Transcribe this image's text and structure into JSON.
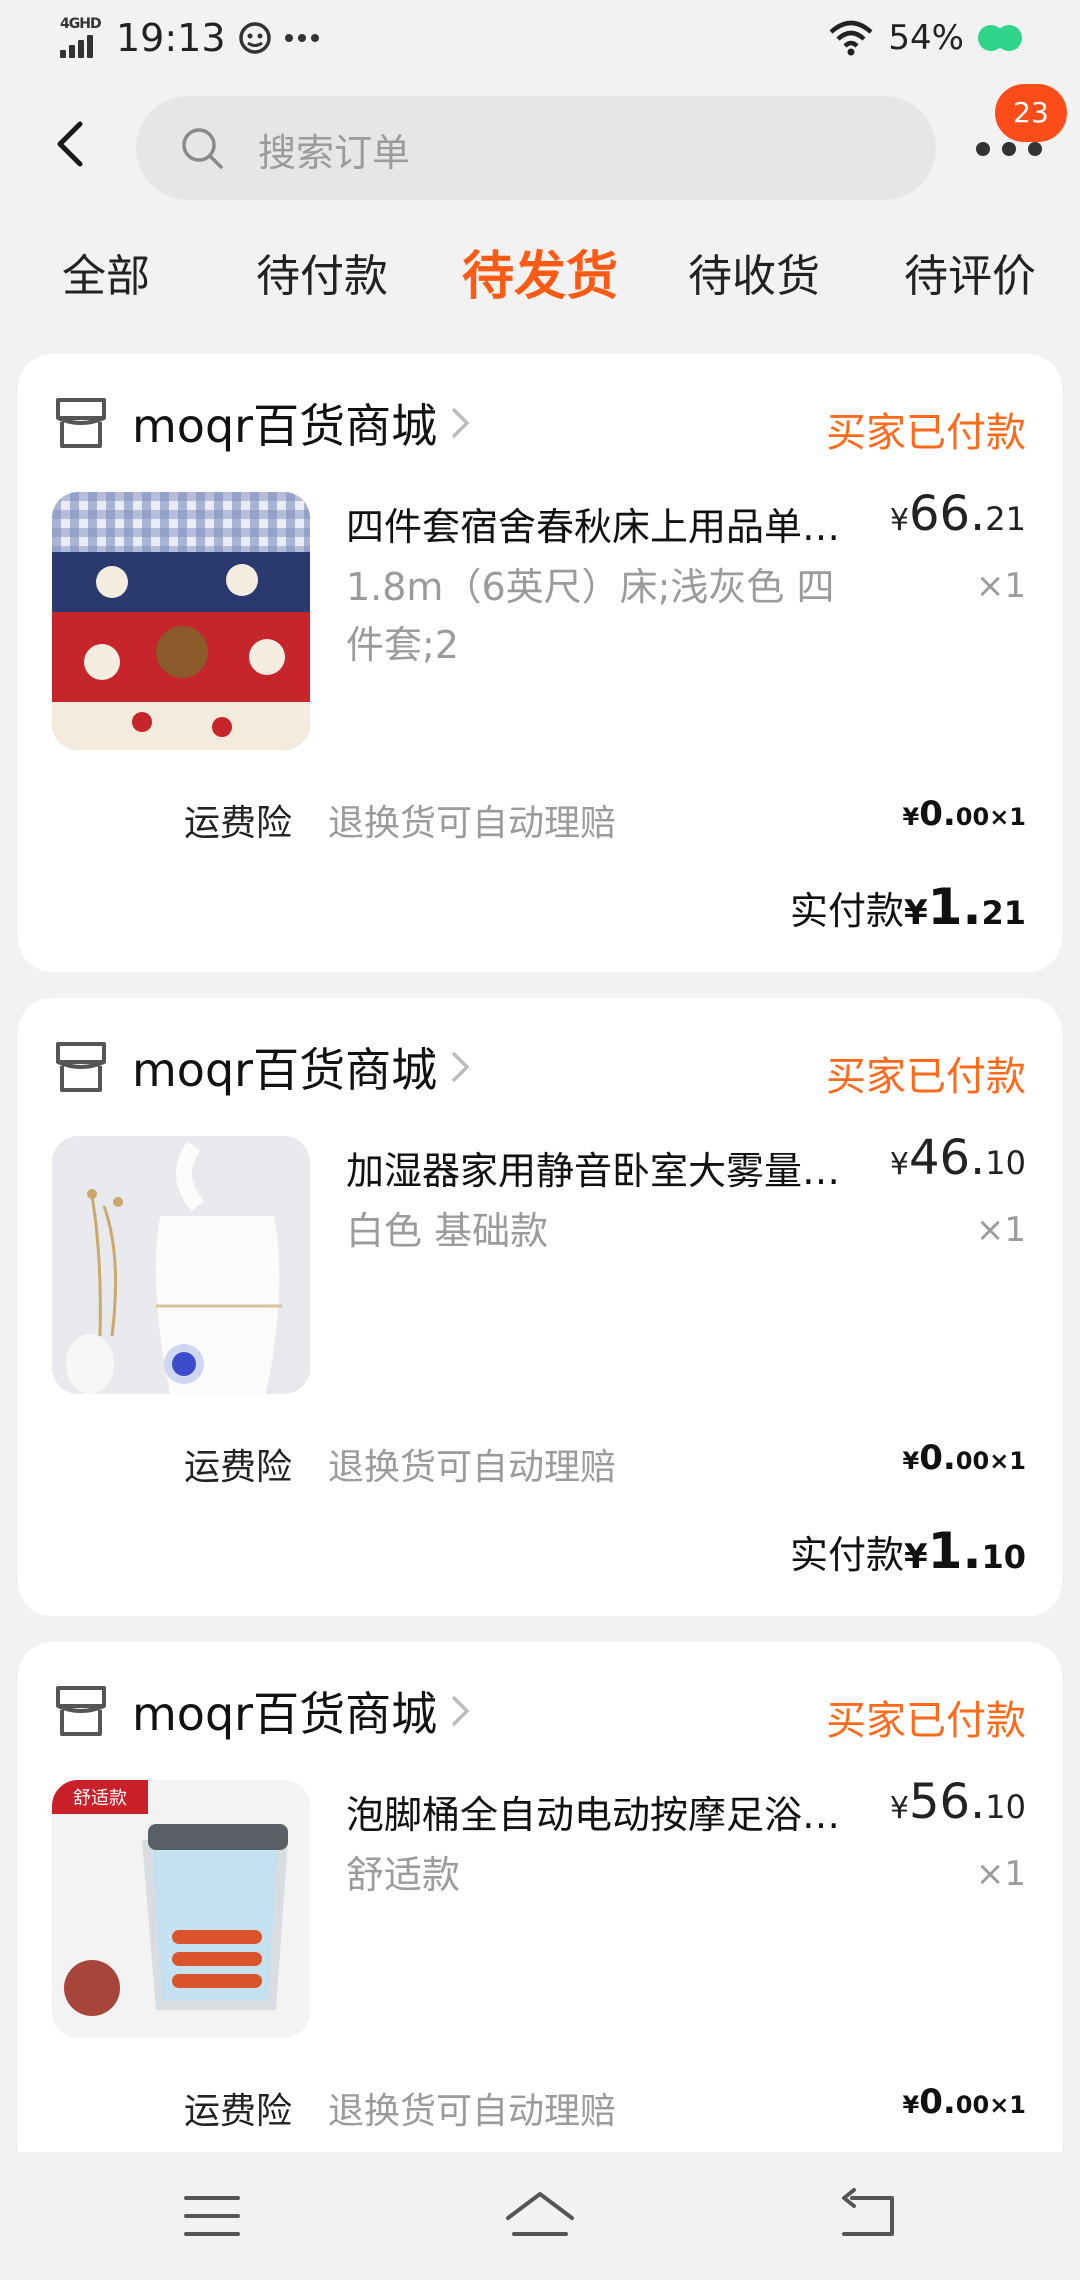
{
  "status_bar": {
    "network": "4GHD",
    "time": "19:13",
    "battery": "54%",
    "colors": {
      "battery_indicator": "#2ed58a"
    }
  },
  "header": {
    "search_placeholder": "搜索订单",
    "message_count": "23",
    "icons": [
      "back-arrow-icon",
      "search-icon",
      "more-icon"
    ]
  },
  "tabs": [
    {
      "label": "全部",
      "active": false
    },
    {
      "label": "待付款",
      "active": false
    },
    {
      "label": "待发货",
      "active": true
    },
    {
      "label": "待收货",
      "active": false
    },
    {
      "label": "待评价",
      "active": false
    }
  ],
  "colors": {
    "accent": "#ff5a14",
    "status": "#ff6a1a",
    "badge": "#ff4d1a"
  },
  "orders": [
    {
      "shop": "moqr百货商城",
      "status": "买家已付款",
      "title": "四件套宿舍春秋床上用品单人床单被套网红学生",
      "spec": "1.8m（6英尺）床;浅灰色 四件套;2",
      "price_symbol": "¥",
      "price_int": "66.",
      "price_dec": "21",
      "qty": "×1",
      "insurance_label": "运费险",
      "insurance_desc": "退换货可自动理赔",
      "insurance_symbol": "¥",
      "insurance_int": "0.",
      "insurance_dec": "00",
      "insurance_qty": "×1",
      "paid_label": "实付款",
      "paid_symbol": "¥",
      "paid_int": "1.",
      "paid_dec": "21"
    },
    {
      "shop": "moqr百货商城",
      "status": "买家已付款",
      "title": "加湿器家用静音卧室大雾量空气净化香薰机",
      "spec": "白色 基础款",
      "price_symbol": "¥",
      "price_int": "46.",
      "price_dec": "10",
      "qty": "×1",
      "insurance_label": "运费险",
      "insurance_desc": "退换货可自动理赔",
      "insurance_symbol": "¥",
      "insurance_int": "0.",
      "insurance_dec": "00",
      "insurance_qty": "×1",
      "paid_label": "实付款",
      "paid_symbol": "¥",
      "paid_int": "1.",
      "paid_dec": "10"
    },
    {
      "shop": "moqr百货商城",
      "status": "买家已付款",
      "title": "泡脚桶全自动电动按摩足浴盆家用加热恒温",
      "spec": "舒适款",
      "thumb_badge": "舒适款",
      "price_symbol": "¥",
      "price_int": "56.",
      "price_dec": "10",
      "qty": "×1",
      "insurance_label": "运费险",
      "insurance_desc": "退换货可自动理赔",
      "insurance_symbol": "¥",
      "insurance_int": "0.",
      "insurance_dec": "00",
      "insurance_qty": "×1"
    }
  ],
  "nav_bar": {
    "icons": [
      "menu-icon",
      "home-icon",
      "back-icon"
    ]
  }
}
